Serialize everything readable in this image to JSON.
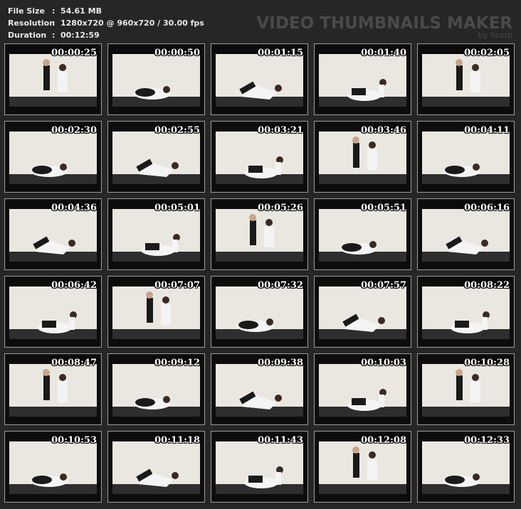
{
  "info": {
    "rows": [
      {
        "label": "File Size",
        "value": "54.61 MB"
      },
      {
        "label": "Resolution",
        "value": "1280x720 @ 960x720 / 30.00 fps"
      },
      {
        "label": "Duration",
        "value": "00:12:59"
      }
    ],
    "separator": ":"
  },
  "brand": {
    "title": "VIDEO THUMBNAILS MAKER",
    "subtitle": "by Scorp"
  },
  "colors": {
    "background": "#262626",
    "wall": "#e9e7e0",
    "floor": "#2e2e2e",
    "border": "#9a9a9a"
  },
  "thumbnails": [
    "00:00:25",
    "00:00:50",
    "00:01:15",
    "00:01:40",
    "00:02:05",
    "00:02:30",
    "00:02:55",
    "00:03:21",
    "00:03:46",
    "00:04:11",
    "00:04:36",
    "00:05:01",
    "00:05:26",
    "00:05:51",
    "00:06:16",
    "00:06:42",
    "00:07:07",
    "00:07:32",
    "00:07:57",
    "00:08:22",
    "00:08:47",
    "00:09:12",
    "00:09:38",
    "00:10:03",
    "00:10:28",
    "00:10:53",
    "00:11:18",
    "00:11:43",
    "00:12:08",
    "00:12:33"
  ]
}
